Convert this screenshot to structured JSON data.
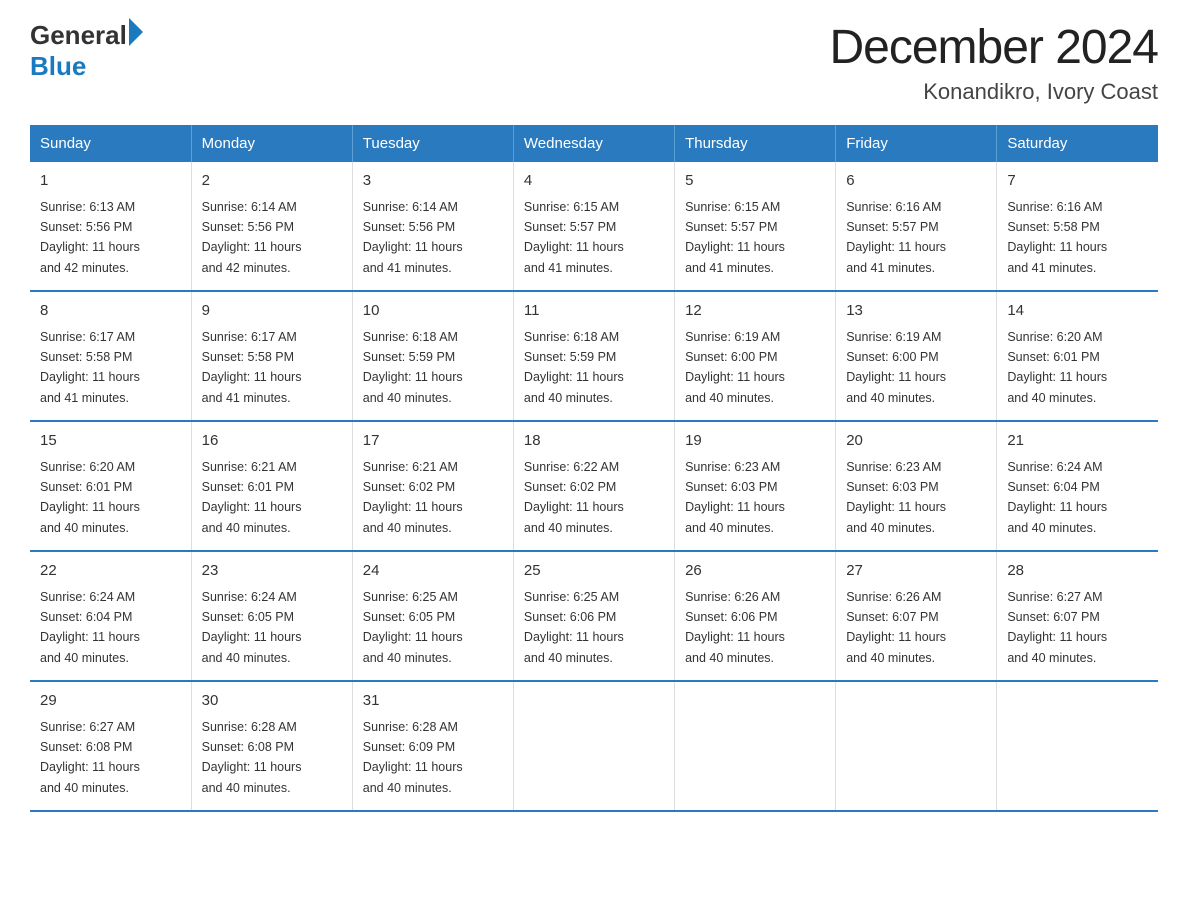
{
  "header": {
    "logo_general": "General",
    "logo_blue": "Blue",
    "title": "December 2024",
    "subtitle": "Konandikro, Ivory Coast"
  },
  "days_of_week": [
    "Sunday",
    "Monday",
    "Tuesday",
    "Wednesday",
    "Thursday",
    "Friday",
    "Saturday"
  ],
  "weeks": [
    [
      {
        "day": "1",
        "sunrise": "6:13 AM",
        "sunset": "5:56 PM",
        "daylight": "11 hours and 42 minutes."
      },
      {
        "day": "2",
        "sunrise": "6:14 AM",
        "sunset": "5:56 PM",
        "daylight": "11 hours and 42 minutes."
      },
      {
        "day": "3",
        "sunrise": "6:14 AM",
        "sunset": "5:56 PM",
        "daylight": "11 hours and 41 minutes."
      },
      {
        "day": "4",
        "sunrise": "6:15 AM",
        "sunset": "5:57 PM",
        "daylight": "11 hours and 41 minutes."
      },
      {
        "day": "5",
        "sunrise": "6:15 AM",
        "sunset": "5:57 PM",
        "daylight": "11 hours and 41 minutes."
      },
      {
        "day": "6",
        "sunrise": "6:16 AM",
        "sunset": "5:57 PM",
        "daylight": "11 hours and 41 minutes."
      },
      {
        "day": "7",
        "sunrise": "6:16 AM",
        "sunset": "5:58 PM",
        "daylight": "11 hours and 41 minutes."
      }
    ],
    [
      {
        "day": "8",
        "sunrise": "6:17 AM",
        "sunset": "5:58 PM",
        "daylight": "11 hours and 41 minutes."
      },
      {
        "day": "9",
        "sunrise": "6:17 AM",
        "sunset": "5:58 PM",
        "daylight": "11 hours and 41 minutes."
      },
      {
        "day": "10",
        "sunrise": "6:18 AM",
        "sunset": "5:59 PM",
        "daylight": "11 hours and 40 minutes."
      },
      {
        "day": "11",
        "sunrise": "6:18 AM",
        "sunset": "5:59 PM",
        "daylight": "11 hours and 40 minutes."
      },
      {
        "day": "12",
        "sunrise": "6:19 AM",
        "sunset": "6:00 PM",
        "daylight": "11 hours and 40 minutes."
      },
      {
        "day": "13",
        "sunrise": "6:19 AM",
        "sunset": "6:00 PM",
        "daylight": "11 hours and 40 minutes."
      },
      {
        "day": "14",
        "sunrise": "6:20 AM",
        "sunset": "6:01 PM",
        "daylight": "11 hours and 40 minutes."
      }
    ],
    [
      {
        "day": "15",
        "sunrise": "6:20 AM",
        "sunset": "6:01 PM",
        "daylight": "11 hours and 40 minutes."
      },
      {
        "day": "16",
        "sunrise": "6:21 AM",
        "sunset": "6:01 PM",
        "daylight": "11 hours and 40 minutes."
      },
      {
        "day": "17",
        "sunrise": "6:21 AM",
        "sunset": "6:02 PM",
        "daylight": "11 hours and 40 minutes."
      },
      {
        "day": "18",
        "sunrise": "6:22 AM",
        "sunset": "6:02 PM",
        "daylight": "11 hours and 40 minutes."
      },
      {
        "day": "19",
        "sunrise": "6:23 AM",
        "sunset": "6:03 PM",
        "daylight": "11 hours and 40 minutes."
      },
      {
        "day": "20",
        "sunrise": "6:23 AM",
        "sunset": "6:03 PM",
        "daylight": "11 hours and 40 minutes."
      },
      {
        "day": "21",
        "sunrise": "6:24 AM",
        "sunset": "6:04 PM",
        "daylight": "11 hours and 40 minutes."
      }
    ],
    [
      {
        "day": "22",
        "sunrise": "6:24 AM",
        "sunset": "6:04 PM",
        "daylight": "11 hours and 40 minutes."
      },
      {
        "day": "23",
        "sunrise": "6:24 AM",
        "sunset": "6:05 PM",
        "daylight": "11 hours and 40 minutes."
      },
      {
        "day": "24",
        "sunrise": "6:25 AM",
        "sunset": "6:05 PM",
        "daylight": "11 hours and 40 minutes."
      },
      {
        "day": "25",
        "sunrise": "6:25 AM",
        "sunset": "6:06 PM",
        "daylight": "11 hours and 40 minutes."
      },
      {
        "day": "26",
        "sunrise": "6:26 AM",
        "sunset": "6:06 PM",
        "daylight": "11 hours and 40 minutes."
      },
      {
        "day": "27",
        "sunrise": "6:26 AM",
        "sunset": "6:07 PM",
        "daylight": "11 hours and 40 minutes."
      },
      {
        "day": "28",
        "sunrise": "6:27 AM",
        "sunset": "6:07 PM",
        "daylight": "11 hours and 40 minutes."
      }
    ],
    [
      {
        "day": "29",
        "sunrise": "6:27 AM",
        "sunset": "6:08 PM",
        "daylight": "11 hours and 40 minutes."
      },
      {
        "day": "30",
        "sunrise": "6:28 AM",
        "sunset": "6:08 PM",
        "daylight": "11 hours and 40 minutes."
      },
      {
        "day": "31",
        "sunrise": "6:28 AM",
        "sunset": "6:09 PM",
        "daylight": "11 hours and 40 minutes."
      },
      null,
      null,
      null,
      null
    ]
  ],
  "labels": {
    "sunrise": "Sunrise:",
    "sunset": "Sunset:",
    "daylight": "Daylight:"
  }
}
